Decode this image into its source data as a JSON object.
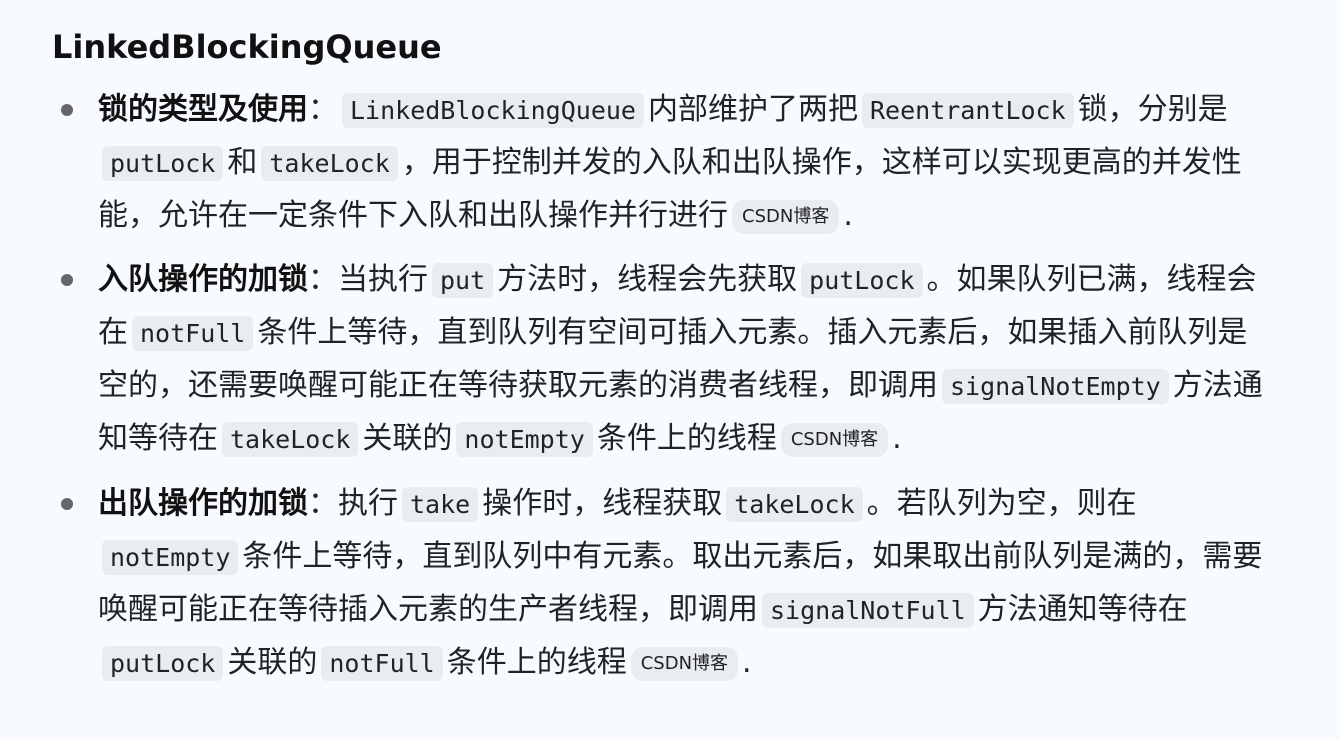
{
  "heading": "LinkedBlockingQueue",
  "items": [
    {
      "title": "锁的类型及使用",
      "sep": "：",
      "c1": "LinkedBlockingQueue",
      "t1": "内部维护了两把",
      "c2": "ReentrantLock",
      "t2": "锁，分别是",
      "c3": "putLock",
      "t3": "和",
      "c4": "takeLock",
      "t4": "，用于控制并发的入队和出队操作，这样可以实现更高的并发性能，允许在一定条件下入队和出队操作并行进行",
      "cite": "CSDN博客",
      "end": "."
    },
    {
      "title": "入队操作的加锁",
      "sep": "：",
      "t0": "当执行",
      "c1": "put",
      "t1": "方法时，线程会先获取",
      "c2": "putLock",
      "t2": "。如果队列已满，线程会在",
      "c3": "notFull",
      "t3": "条件上等待，直到队列有空间可插入元素。插入元素后，如果插入前队列是空的，还需要唤醒可能正在等待获取元素的消费者线程，即调用",
      "c4": "signalNotEmpty",
      "t4": "方法通知等待在",
      "c5": "takeLock",
      "t5": "关联的",
      "c6": "notEmpty",
      "t6": "条件上的线程",
      "cite": "CSDN博客",
      "end": "."
    },
    {
      "title": "出队操作的加锁",
      "sep": "：",
      "t0": "执行",
      "c1": "take",
      "t1": "操作时，线程获取",
      "c2": "takeLock",
      "t2": "。若队列为空，则在",
      "c3": "notEmpty",
      "t3": "条件上等待，直到队列中有元素。取出元素后，如果取出前队列是满的，需要唤醒可能正在等待插入元素的生产者线程，即调用",
      "c4": "signalNotFull",
      "t4": "方法通知等待在",
      "c5": "putLock",
      "t5": "关联的",
      "c6": "notFull",
      "t6": "条件上的线程",
      "cite": "CSDN博客",
      "end": "."
    }
  ]
}
